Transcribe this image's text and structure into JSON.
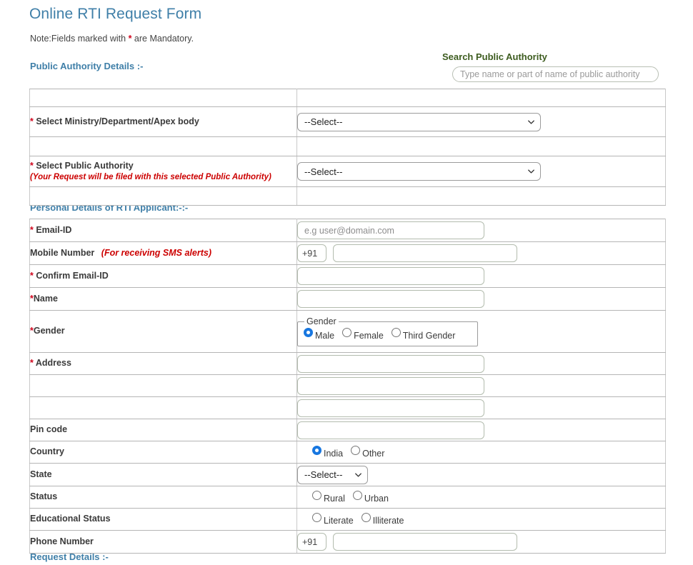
{
  "page": {
    "title": "Online RTI Request Form",
    "note_prefix": "Note:Fields marked with ",
    "note_star": "*",
    "note_suffix": " are Mandatory."
  },
  "search": {
    "label": "Search Public Authority",
    "placeholder": "Type name or part of name of public authority",
    "value": ""
  },
  "sections": {
    "public_authority": "Public Authority Details :-",
    "personal_details": "Personal Details of RTI Applicant:-:-",
    "request_details": "Request Details :-"
  },
  "public_authority_rows": {
    "ministry": {
      "star": "*",
      "label": " Select Ministry/Department/Apex body",
      "select_value": "--Select--"
    },
    "authority": {
      "star": "*",
      "label": " Select Public Authority",
      "sub_label": "(Your Request will be filed with this selected Public Authority)",
      "select_value": "--Select--"
    }
  },
  "personal_rows": {
    "email": {
      "star": "*",
      "label": " Email-ID",
      "placeholder": "e.g user@domain.com",
      "value": ""
    },
    "mobile": {
      "label": "Mobile Number",
      "note": "(For receiving SMS alerts)",
      "country_code": "+91",
      "value": ""
    },
    "confirm_email": {
      "star": "*",
      "label": " Confirm Email-ID",
      "value": ""
    },
    "name": {
      "star": "*",
      "label": "Name",
      "value": ""
    },
    "gender": {
      "star": "*",
      "label": "Gender",
      "legend": "Gender",
      "options": [
        {
          "label": "Male",
          "selected": true
        },
        {
          "label": "Female",
          "selected": false
        },
        {
          "label": "Third Gender",
          "selected": false
        }
      ]
    },
    "address": {
      "star": "*",
      "label": " Address",
      "value_line1": "",
      "value_line2": "",
      "value_line3": ""
    },
    "pincode": {
      "label": "Pin code",
      "value": ""
    },
    "country": {
      "label": "Country",
      "options": [
        {
          "label": "India",
          "selected": true
        },
        {
          "label": "Other",
          "selected": false
        }
      ]
    },
    "state": {
      "label": "State",
      "select_value": "--Select--"
    },
    "status": {
      "label": "Status",
      "options": [
        {
          "label": "Rural",
          "selected": false
        },
        {
          "label": "Urban",
          "selected": false
        }
      ]
    },
    "educational_status": {
      "label": "Educational Status",
      "options": [
        {
          "label": "Literate",
          "selected": false
        },
        {
          "label": "Illiterate",
          "selected": false
        }
      ]
    },
    "phone": {
      "label": "Phone Number",
      "country_code": "+91",
      "value": ""
    }
  },
  "colors": {
    "heading_blue": "#3f7fa8",
    "mandatory_red": "#d0021b",
    "search_label_green": "#3d5c1f",
    "radio_selected_blue": "#1877e0"
  }
}
